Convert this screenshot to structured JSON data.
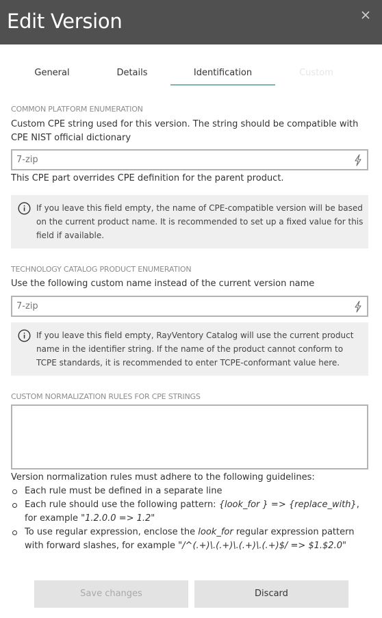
{
  "dialog": {
    "title": "Edit Version"
  },
  "tabs": [
    {
      "label": "General",
      "state": "normal"
    },
    {
      "label": "Details",
      "state": "normal"
    },
    {
      "label": "Identification",
      "state": "active"
    },
    {
      "label": "Custom",
      "state": "disabled"
    }
  ],
  "cpe": {
    "section_label": "COMMON PLATFORM ENUMERATION",
    "description": "Custom CPE string used for this version. The string should be compatible with CPE NIST official dictionary",
    "placeholder": "7-zip",
    "value": "",
    "note": "This CPE part overrides CPE definition for the parent product.",
    "info": "If you leave this field empty, the name of CPE-compatible version will be based on the current product name. It is recommended to set up a fixed value for this field if available."
  },
  "tcpe": {
    "section_label": "TECHNOLOGY CATALOG PRODUCT ENUMERATION",
    "description": "Use the following custom name instead of the current version name",
    "placeholder": "7-zip",
    "value": "",
    "info": "If you leave this field empty, RayVentory Catalog will use the current product name in the identifier string. If the name of the product cannot conform to TCPE standards, it is recommended to enter TCPE-conformant value here."
  },
  "normalization": {
    "section_label": "CUSTOM NORMALIZATION RULES FOR CPE STRINGS",
    "value": "",
    "guidelines_intro": "Version normalization rules must adhere to the following guidelines:",
    "rule1": "Each rule must be defined in a separate line",
    "rule2_a": "Each rule should use the following pattern: ",
    "rule2_pattern": "{look_for } => {replace_with}",
    "rule2_b": ", for example \"",
    "rule2_example": "1.2.0.0 => 1.2",
    "rule2_c": "\"",
    "rule3_a": "To use regular expression, enclose the ",
    "rule3_term": "look_for",
    "rule3_b": " regular expression pattern with forward slashes, for example \"",
    "rule3_example": "/^(.+)\\.(.+)\\.(.+)\\.(.+)$/ => $1.$2.0",
    "rule3_c": "\""
  },
  "buttons": {
    "save": "Save changes",
    "discard": "Discard"
  },
  "colors": {
    "header_bg": "#505050",
    "tab_underline": "#7fb5b0",
    "info_bg": "#efefef",
    "button_bg": "#e3e3e3"
  },
  "icons": {
    "close": "close-icon",
    "bolt": "lightning-icon",
    "info": "info-icon"
  }
}
